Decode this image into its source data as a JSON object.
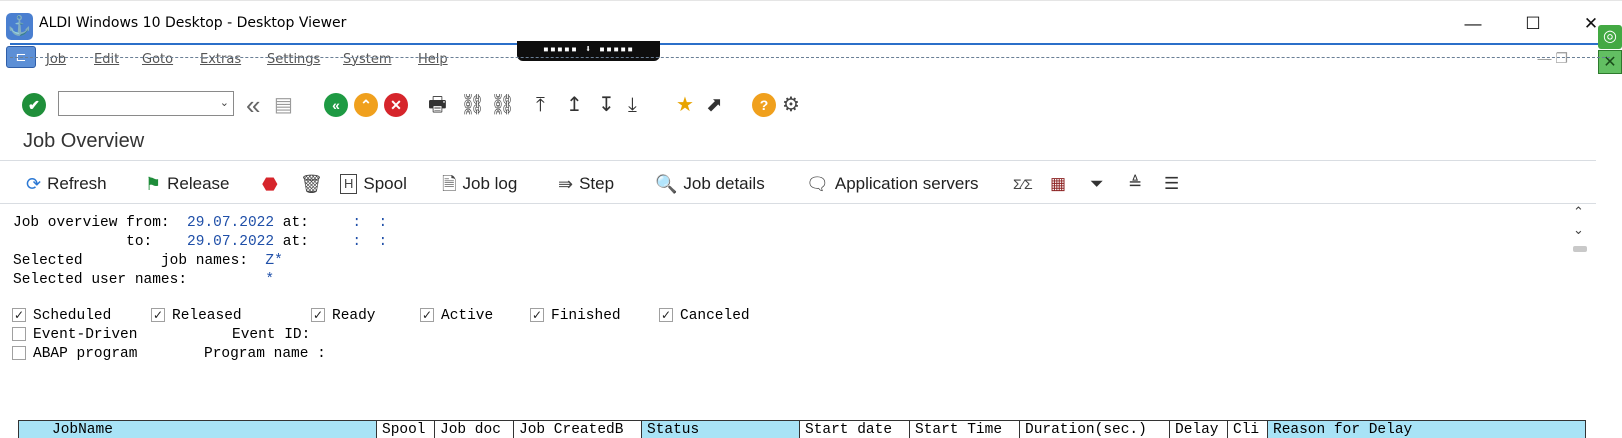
{
  "window": {
    "title": "ALDI Windows 10 Desktop - Desktop Viewer",
    "minimize": "—",
    "maximize": "☐",
    "close": "✕",
    "viewer_bar": "▪▪▪▪▪ ⬇ ▪▪▪▪▪"
  },
  "menu": {
    "items": [
      "Job",
      "Edit",
      "Goto",
      "Extras",
      "Settings",
      "System",
      "Help"
    ]
  },
  "toolbar": {
    "command_field_value": "",
    "icons": [
      "enter-icon",
      "back-double-icon",
      "save-icon",
      "back-icon",
      "exit-icon",
      "cancel-icon",
      "print-icon",
      "find-icon",
      "find-next-icon",
      "first-page-icon",
      "previous-page-icon",
      "next-page-icon",
      "last-page-icon",
      "create-session-icon",
      "shortcut-icon",
      "help-icon",
      "customize-icon"
    ]
  },
  "page": {
    "title": "Job Overview"
  },
  "app_toolbar": {
    "refresh": "Refresh",
    "release": "Release",
    "spool": "Spool",
    "job_log": "Job log",
    "step": "Step",
    "job_details": "Job details",
    "application_servers": "Application servers"
  },
  "filters": {
    "from_label": "Job overview from:",
    "from_date": "29.07.2022",
    "at_label": "at:",
    "from_time": ":  :",
    "to_label": "to:",
    "to_date": "29.07.2022",
    "to_time": ":  :",
    "selected_label": "Selected",
    "job_names_label": "job names:",
    "job_names_value": "Z*",
    "user_names_label": "Selected user names:",
    "user_names_value": "*"
  },
  "statuses": [
    {
      "label": "Scheduled",
      "checked": true
    },
    {
      "label": "Released",
      "checked": true
    },
    {
      "label": "Ready",
      "checked": true
    },
    {
      "label": "Active",
      "checked": true
    },
    {
      "label": "Finished",
      "checked": true
    },
    {
      "label": "Canceled",
      "checked": true
    }
  ],
  "options": {
    "event_driven": {
      "label": "Event-Driven",
      "checked": false
    },
    "event_id_label": "Event ID:",
    "abap_program": {
      "label": "ABAP program",
      "checked": false
    },
    "program_name_label": "Program name :"
  },
  "table": {
    "headers": [
      "JobName",
      "Spool",
      "Job doc",
      "Job CreatedB",
      "Status",
      "Start date",
      "Start Time",
      "Duration(sec.)",
      "Delay",
      "Cli",
      "Reason for Delay"
    ]
  },
  "colors": {
    "header_fill": "#a8e3f6",
    "value_text": "#1f4fa8",
    "accent_blue": "#2b6fc9"
  }
}
